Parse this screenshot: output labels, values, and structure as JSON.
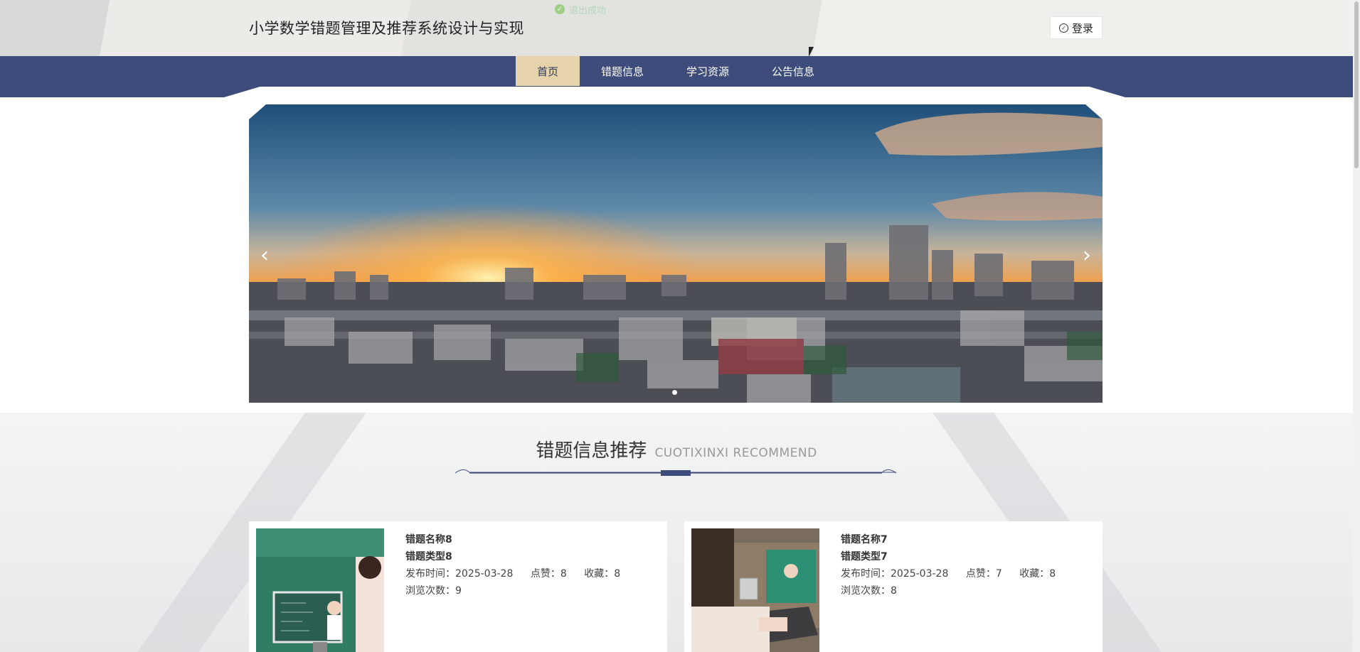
{
  "header": {
    "site_title": "小学数学错题管理及推荐系统设计与实现",
    "toast_text": "退出成功",
    "login_label": "登录"
  },
  "nav": {
    "items": [
      {
        "label": "首页",
        "active": true
      },
      {
        "label": "错题信息",
        "active": false
      },
      {
        "label": "学习资源",
        "active": false
      },
      {
        "label": "公告信息",
        "active": false
      }
    ]
  },
  "carousel": {
    "prev_icon": "chevron-left-icon",
    "next_icon": "chevron-right-icon"
  },
  "section": {
    "title_cn": "错题信息推荐",
    "title_en": "CUOTIXINXI RECOMMEND"
  },
  "cards": [
    {
      "name": "错题名称8",
      "type": "错题类型8",
      "publish": "发布时间：2025-03-28",
      "likes": "点赞：8",
      "favorites": "收藏：8",
      "views": "浏览次数：9"
    },
    {
      "name": "错题名称7",
      "type": "错题类型7",
      "publish": "发布时间：2025-03-28",
      "likes": "点赞：7",
      "favorites": "收藏：8",
      "views": "浏览次数：8"
    }
  ],
  "colors": {
    "nav_bg": "#3d4c7a",
    "nav_active_bg": "#e6d2ab",
    "accent": "#3d4c7a"
  }
}
